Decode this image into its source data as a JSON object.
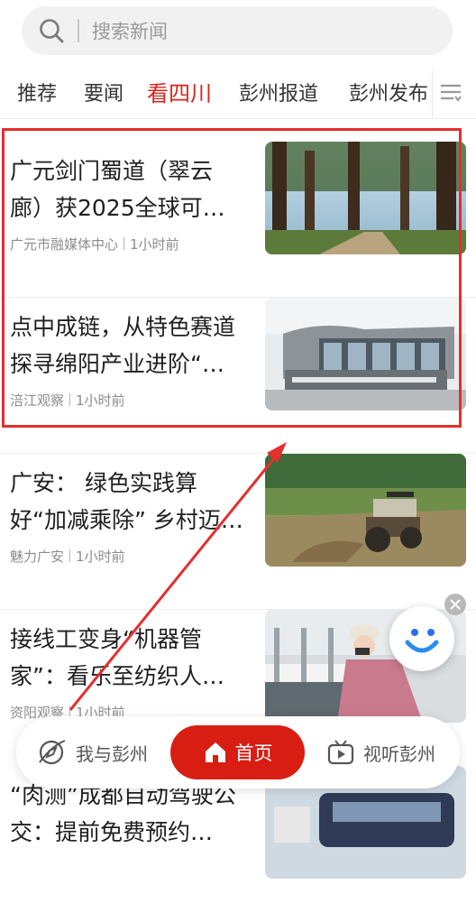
{
  "search": {
    "placeholder": "搜索新闻"
  },
  "tabs": [
    {
      "label": "推荐",
      "active": false
    },
    {
      "label": "要闻",
      "active": false
    },
    {
      "label": "看四川",
      "active": true
    },
    {
      "label": "彭州报道",
      "active": false
    },
    {
      "label": "彭州发布",
      "active": false
    }
  ],
  "news": [
    {
      "title": "广元剑门蜀道（翠云廊）获2025全球可持…",
      "source": "广元市融媒体中心",
      "time": "1小时前",
      "image": "forest-trees"
    },
    {
      "title": "点中成链，从特色赛道探寻绵阳产业进阶“…",
      "source": "涪江观察",
      "time": "1小时前",
      "image": "sichuan-building"
    },
    {
      "title": "广安： 绿色实践算好“加减乘除” 乡村迈…",
      "source": "魅力广安",
      "time": "1小时前",
      "image": "tractor-field"
    },
    {
      "title": "接线工变身“机器管家”：看乐至纺织人…",
      "source": "资阳观察",
      "time": "1小时前",
      "image": "textile-worker"
    },
    {
      "title": "“肉测”成都自动驾驶公交：提前免费预约…",
      "source": "",
      "time": "",
      "image": "bus"
    }
  ],
  "bottom_nav": {
    "left": "我与彭州",
    "home": "首页",
    "right": "视听彭州"
  },
  "colors": {
    "accent": "#d81e12",
    "highlight": "#e52e2e"
  }
}
